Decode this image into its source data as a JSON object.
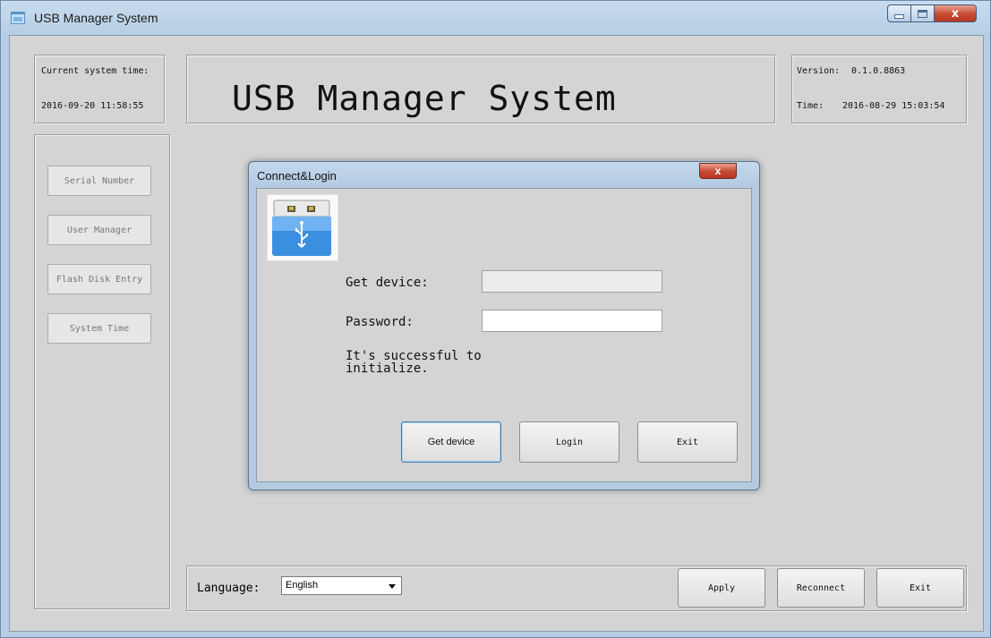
{
  "window": {
    "title": "USB Manager System",
    "close_glyph": "x"
  },
  "time_panel": {
    "label": "Current system time:",
    "value": "2016-09-20 11:58:55"
  },
  "banner": {
    "text": "USB Manager System"
  },
  "version_panel": {
    "version_label": "Version:",
    "version_value": "0.1.0.8863",
    "time_label": "Time:",
    "time_value": "2016-08-29 15:03:54"
  },
  "sidebar": {
    "items": [
      {
        "label": "Serial Number"
      },
      {
        "label": "User Manager"
      },
      {
        "label": "Flash Disk Entry"
      },
      {
        "label": "System Time"
      }
    ]
  },
  "bottom_bar": {
    "language_label": "Language:",
    "language_value": "English",
    "apply_label": "Apply",
    "reconnect_label": "Reconnect",
    "exit_label": "Exit"
  },
  "dialog": {
    "title": "Connect&Login",
    "close_glyph": "x",
    "get_device_label": "Get device:",
    "get_device_value": "",
    "password_label": "Password:",
    "password_value": "",
    "message": "It's successful to initialize.",
    "buttons": {
      "get_device": "Get device",
      "login": "Login",
      "exit": "Exit"
    }
  },
  "icons": [
    "app-icon",
    "minimize-icon",
    "maximize-icon",
    "close-icon",
    "usb-drive-icon",
    "dropdown-arrow-icon"
  ],
  "colors": {
    "window_frame": "#b6cde3",
    "client_bg": "#d4d4d4",
    "close_button": "#c44a31",
    "usb_icon_blue": "#3a8fe0"
  }
}
